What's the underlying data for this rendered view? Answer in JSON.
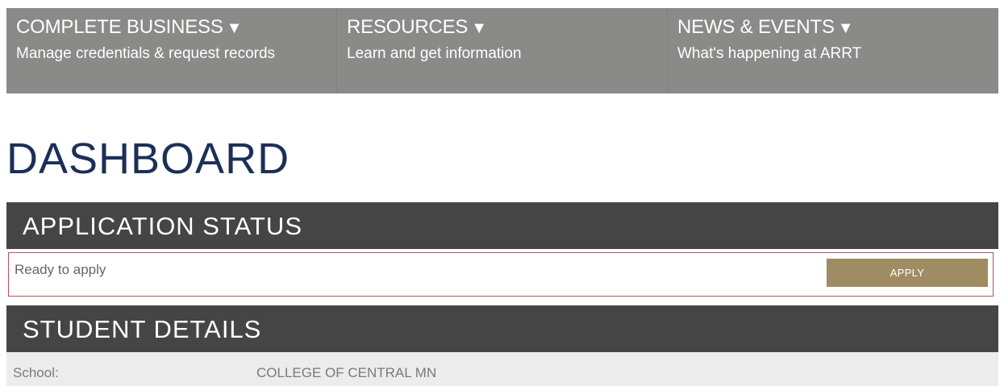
{
  "nav": [
    {
      "title": "COMPLETE BUSINESS",
      "arrow": "▼",
      "subtitle": "Manage credentials & request records"
    },
    {
      "title": "RESOURCES",
      "arrow": "▼",
      "subtitle": "Learn and get information"
    },
    {
      "title": "NEWS & EVENTS",
      "arrow": "▼",
      "subtitle": "What's happening at ARRT"
    }
  ],
  "page_title": "DASHBOARD",
  "application_status": {
    "heading": "APPLICATION STATUS",
    "status_text": "Ready to apply",
    "apply_label": "APPLY"
  },
  "student_details": {
    "heading": "STUDENT DETAILS",
    "rows": [
      {
        "label": "School:",
        "value": "COLLEGE OF CENTRAL MN"
      }
    ]
  },
  "colors": {
    "nav_bg": "#8a8a89",
    "section_bar": "#454545",
    "title": "#1c2f5a",
    "apply_button": "#9f8c63",
    "status_border": "#b9535b"
  }
}
